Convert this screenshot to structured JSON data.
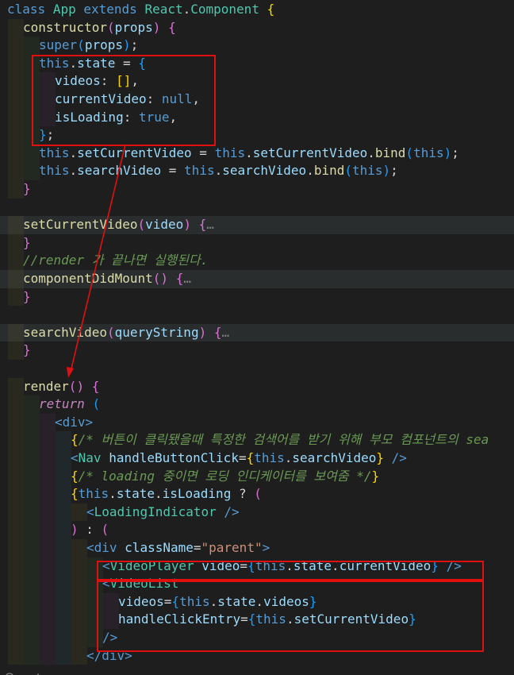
{
  "editor": {
    "lines": [
      [
        [
          "keyword",
          "class"
        ],
        [
          "plain",
          " "
        ],
        [
          "class",
          "App"
        ],
        [
          "plain",
          " "
        ],
        [
          "keyword",
          "extends"
        ],
        [
          "plain",
          " "
        ],
        [
          "class",
          "React"
        ],
        [
          "plain",
          "."
        ],
        [
          "class",
          "Component"
        ],
        [
          "plain",
          " "
        ],
        [
          "bracket1",
          "{"
        ]
      ],
      [
        [
          "function",
          "constructor"
        ],
        [
          "bracket2",
          "("
        ],
        [
          "var",
          "props"
        ],
        [
          "bracket2",
          ")"
        ],
        [
          "plain",
          " "
        ],
        [
          "bracket2",
          "{"
        ]
      ],
      [
        [
          "keyword",
          "super"
        ],
        [
          "bracket3",
          "("
        ],
        [
          "var",
          "props"
        ],
        [
          "bracket3",
          ")"
        ],
        [
          "plain",
          ";"
        ]
      ],
      [
        [
          "keyword",
          "this"
        ],
        [
          "plain",
          "."
        ],
        [
          "var",
          "state"
        ],
        [
          "plain",
          " = "
        ],
        [
          "bracket3",
          "{"
        ]
      ],
      [
        [
          "var",
          "videos"
        ],
        [
          "plain",
          ": "
        ],
        [
          "bracket1",
          "["
        ],
        [
          "bracket1",
          "]"
        ],
        [
          "plain",
          ","
        ]
      ],
      [
        [
          "var",
          "currentVideo"
        ],
        [
          "plain",
          ": "
        ],
        [
          "keyword",
          "null"
        ],
        [
          "plain",
          ","
        ]
      ],
      [
        [
          "var",
          "isLoading"
        ],
        [
          "plain",
          ": "
        ],
        [
          "keyword",
          "true"
        ],
        [
          "plain",
          ","
        ]
      ],
      [
        [
          "bracket3",
          "}"
        ],
        [
          "plain",
          ";"
        ]
      ],
      [
        [
          "keyword",
          "this"
        ],
        [
          "plain",
          "."
        ],
        [
          "var",
          "setCurrentVideo"
        ],
        [
          "plain",
          " = "
        ],
        [
          "keyword",
          "this"
        ],
        [
          "plain",
          "."
        ],
        [
          "var",
          "setCurrentVideo"
        ],
        [
          "plain",
          "."
        ],
        [
          "function",
          "bind"
        ],
        [
          "bracket3",
          "("
        ],
        [
          "keyword",
          "this"
        ],
        [
          "bracket3",
          ")"
        ],
        [
          "plain",
          ";"
        ]
      ],
      [
        [
          "keyword",
          "this"
        ],
        [
          "plain",
          "."
        ],
        [
          "var",
          "searchVideo"
        ],
        [
          "plain",
          " = "
        ],
        [
          "keyword",
          "this"
        ],
        [
          "plain",
          "."
        ],
        [
          "var",
          "searchVideo"
        ],
        [
          "plain",
          "."
        ],
        [
          "function",
          "bind"
        ],
        [
          "bracket3",
          "("
        ],
        [
          "keyword",
          "this"
        ],
        [
          "bracket3",
          ")"
        ],
        [
          "plain",
          ";"
        ]
      ],
      [
        [
          "bracket2",
          "}"
        ]
      ],
      [],
      [
        [
          "function",
          "setCurrentVideo"
        ],
        [
          "bracket2",
          "("
        ],
        [
          "var",
          "video"
        ],
        [
          "bracket2",
          ")"
        ],
        [
          "plain",
          " "
        ],
        [
          "bracket2",
          "{"
        ],
        [
          "ellipsis",
          "…"
        ]
      ],
      [
        [
          "bracket2",
          "}"
        ]
      ],
      [
        [
          "comment",
          "//render 가 끝나면 실행된다."
        ]
      ],
      [
        [
          "function",
          "componentDidMount"
        ],
        [
          "bracket2",
          "("
        ],
        [
          "bracket2",
          ")"
        ],
        [
          "plain",
          " "
        ],
        [
          "bracket2",
          "{"
        ],
        [
          "ellipsis",
          "…"
        ]
      ],
      [
        [
          "bracket2",
          "}"
        ]
      ],
      [],
      [
        [
          "function",
          "searchVideo"
        ],
        [
          "bracket2",
          "("
        ],
        [
          "var",
          "queryString"
        ],
        [
          "bracket2",
          ")"
        ],
        [
          "plain",
          " "
        ],
        [
          "bracket2",
          "{"
        ],
        [
          "ellipsis",
          "…"
        ]
      ],
      [
        [
          "bracket2",
          "}"
        ]
      ],
      [],
      [
        [
          "function",
          "render"
        ],
        [
          "bracket2",
          "("
        ],
        [
          "bracket2",
          ")"
        ],
        [
          "plain",
          " "
        ],
        [
          "bracket2",
          "{"
        ]
      ],
      [
        [
          "control",
          "return"
        ],
        [
          "plain",
          " "
        ],
        [
          "bracket3",
          "("
        ]
      ],
      [
        [
          "tag",
          "<div"
        ],
        [
          "tag",
          ">"
        ]
      ],
      [
        [
          "bracket1",
          "{"
        ],
        [
          "comment",
          "/* 버튼이 클릭됐을때 특정한 검색어를 받기 위해 부모 컴포넌트의 sea"
        ]
      ],
      [
        [
          "tag",
          "<"
        ],
        [
          "component",
          "Nav"
        ],
        [
          "plain",
          " "
        ],
        [
          "attr",
          "handleButtonClick"
        ],
        [
          "plain",
          "="
        ],
        [
          "bracket1",
          "{"
        ],
        [
          "keyword",
          "this"
        ],
        [
          "plain",
          "."
        ],
        [
          "var",
          "searchVideo"
        ],
        [
          "bracket1",
          "}"
        ],
        [
          "plain",
          " "
        ],
        [
          "tag",
          "/>"
        ]
      ],
      [
        [
          "bracket1",
          "{"
        ],
        [
          "comment",
          "/* loading 중이면 로딩 인디케이터를 보여줌 */"
        ],
        [
          "bracket1",
          "}"
        ]
      ],
      [
        [
          "bracket1",
          "{"
        ],
        [
          "keyword",
          "this"
        ],
        [
          "plain",
          "."
        ],
        [
          "var",
          "state"
        ],
        [
          "plain",
          "."
        ],
        [
          "var",
          "isLoading"
        ],
        [
          "plain",
          " ? "
        ],
        [
          "bracket2",
          "("
        ]
      ],
      [
        [
          "tag",
          "<"
        ],
        [
          "component",
          "LoadingIndicator"
        ],
        [
          "plain",
          " "
        ],
        [
          "tag",
          "/>"
        ]
      ],
      [
        [
          "bracket2",
          ")"
        ],
        [
          "plain",
          " : "
        ],
        [
          "bracket2",
          "("
        ]
      ],
      [
        [
          "tag",
          "<div"
        ],
        [
          "plain",
          " "
        ],
        [
          "attr",
          "className"
        ],
        [
          "plain",
          "="
        ],
        [
          "string",
          "\"parent\""
        ],
        [
          "tag",
          ">"
        ]
      ],
      [
        [
          "tag",
          "<"
        ],
        [
          "component",
          "VideoPlayer"
        ],
        [
          "plain",
          " "
        ],
        [
          "attr",
          "video"
        ],
        [
          "plain",
          "="
        ],
        [
          "bracket3",
          "{"
        ],
        [
          "keyword",
          "this"
        ],
        [
          "plain",
          "."
        ],
        [
          "var",
          "state"
        ],
        [
          "plain",
          "."
        ],
        [
          "var",
          "currentVideo"
        ],
        [
          "bracket3",
          "}"
        ],
        [
          "plain",
          " "
        ],
        [
          "tag",
          "/>"
        ]
      ],
      [
        [
          "tag",
          "<"
        ],
        [
          "component",
          "VideoList"
        ]
      ],
      [
        [
          "attr",
          "videos"
        ],
        [
          "plain",
          "="
        ],
        [
          "bracket3",
          "{"
        ],
        [
          "keyword",
          "this"
        ],
        [
          "plain",
          "."
        ],
        [
          "var",
          "state"
        ],
        [
          "plain",
          "."
        ],
        [
          "var",
          "videos"
        ],
        [
          "bracket3",
          "}"
        ]
      ],
      [
        [
          "attr",
          "handleClickEntry"
        ],
        [
          "plain",
          "="
        ],
        [
          "bracket3",
          "{"
        ],
        [
          "keyword",
          "this"
        ],
        [
          "plain",
          "."
        ],
        [
          "var",
          "setCurrentVideo"
        ],
        [
          "bracket3",
          "}"
        ]
      ],
      [
        [
          "tag",
          "/>"
        ]
      ],
      [
        [
          "tag",
          "</div"
        ],
        [
          "tag",
          ">"
        ]
      ]
    ]
  },
  "colors": {
    "background": "#1e1e1e",
    "annotation": "#e01010"
  },
  "status_bar": {
    "icons": [
      "error-icon",
      "warning-icon"
    ]
  }
}
